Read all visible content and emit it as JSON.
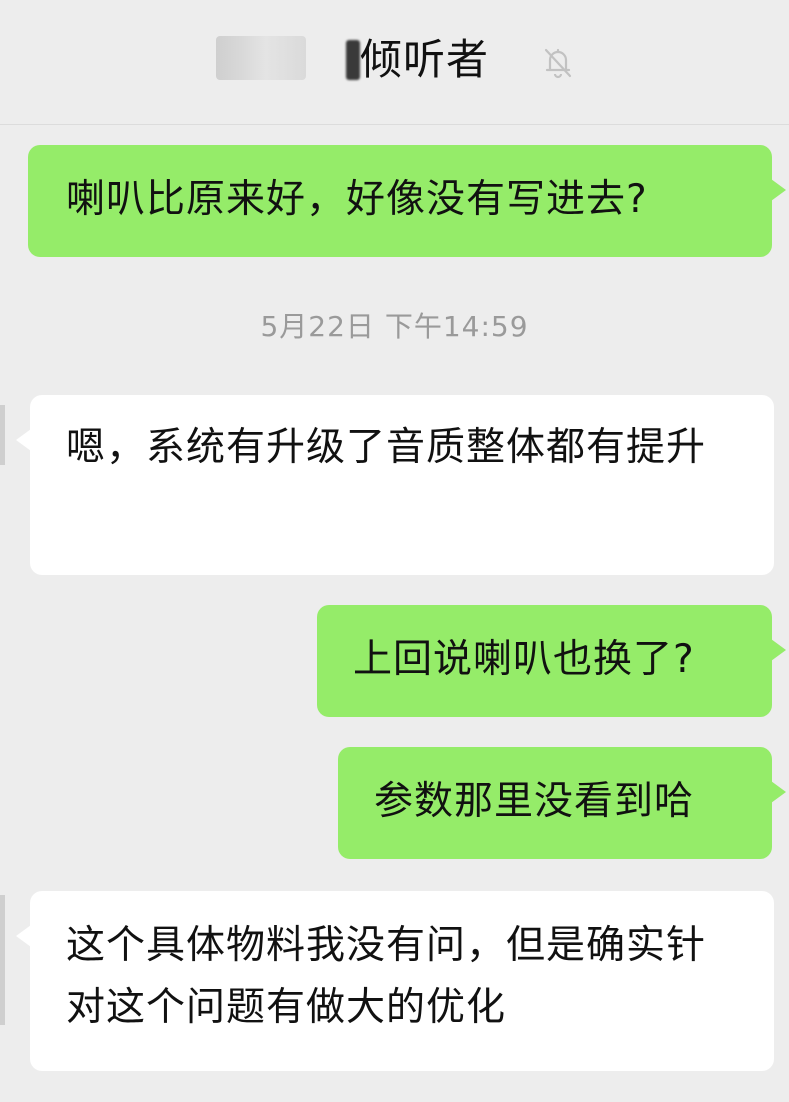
{
  "header": {
    "title": "倾听者",
    "mute_icon": "bell-off-icon"
  },
  "messages": [
    {
      "direction": "outgoing",
      "text": "喇叭比原来好，好像没有写进去?"
    },
    {
      "direction": "incoming",
      "text": "嗯，系统有升级了音质整体都有提升"
    },
    {
      "direction": "outgoing",
      "text": "上回说喇叭也换了?"
    },
    {
      "direction": "outgoing",
      "text": "参数那里没看到哈"
    },
    {
      "direction": "incoming",
      "text": "这个具体物料我没有问，但是确实针对这个问题有做大的优化"
    }
  ],
  "timestamp": "5月22日 下午14:59",
  "colors": {
    "background": "#ededed",
    "outgoing_bubble": "#95ec69",
    "incoming_bubble": "#ffffff",
    "timestamp_text": "#9a9a9a"
  }
}
